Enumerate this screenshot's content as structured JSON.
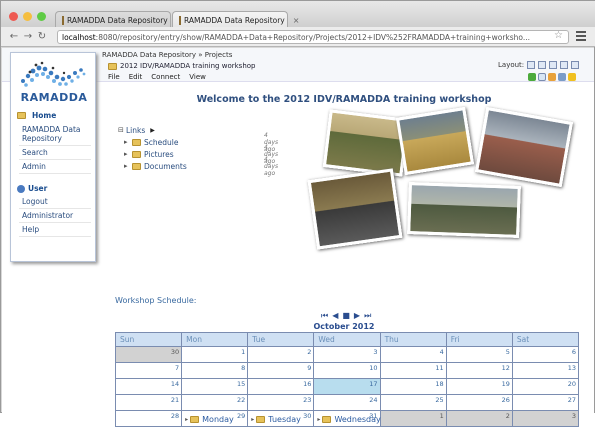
{
  "browser": {
    "tabs": [
      {
        "label": "RAMADDA Data Repository"
      },
      {
        "label": "RAMADDA Data Repository"
      }
    ],
    "url_host": "localhost",
    "url_rest": ":8080/repository/entry/show/RAMADDA+Data+Repository/Projects/2012+IDV%252FRAMADDA+training+worksho..."
  },
  "header": {
    "breadcrumb": "RAMADDA Data Repository » Projects",
    "entry_title": "2012 IDV/RAMADDA training workshop",
    "menus": [
      "File",
      "Edit",
      "Connect",
      "View"
    ],
    "layout_label": "Layout:"
  },
  "sidebar": {
    "logo_text": "RAMADDA",
    "home_label": "Home",
    "home_items": [
      "RAMADDA Data Repository",
      "Search",
      "Admin"
    ],
    "user_label": "User",
    "user_items": [
      "Logout",
      "Administrator",
      "Help"
    ]
  },
  "main": {
    "welcome": "Welcome to the 2012 IDV/RAMADDA training workshop",
    "links_label": "Links",
    "folders": [
      {
        "name": "Schedule",
        "ago": "4 days ago"
      },
      {
        "name": "Pictures",
        "ago": "4 days ago"
      },
      {
        "name": "Documents",
        "ago": "4 days ago"
      }
    ],
    "schedule_label": "Workshop Schedule:",
    "calendar_month": "October 2012",
    "day_headers": [
      "Sun",
      "Mon",
      "Tue",
      "Wed",
      "Thu",
      "Fri",
      "Sat"
    ],
    "weeks": [
      [
        "30",
        "1",
        "2",
        "3",
        "4",
        "5",
        "6"
      ],
      [
        "7",
        "8",
        "9",
        "10",
        "11",
        "12",
        "13"
      ],
      [
        "14",
        "15",
        "16",
        "17",
        "18",
        "19",
        "20"
      ],
      [
        "21",
        "22",
        "23",
        "24",
        "25",
        "26",
        "27"
      ],
      [
        "28",
        "29",
        "30",
        "31",
        "1",
        "2",
        "3"
      ]
    ],
    "events": [
      {
        "day": "29",
        "label": "Monday"
      },
      {
        "day": "30",
        "label": "Tuesday"
      },
      {
        "day": "31",
        "label": "Wednesday"
      }
    ],
    "today": "17"
  },
  "colors": {
    "accent": "#2f4f7f",
    "calendar_header": "#cfe0f3",
    "today": "#b8ddee",
    "other_month": "#d2d2d2"
  }
}
